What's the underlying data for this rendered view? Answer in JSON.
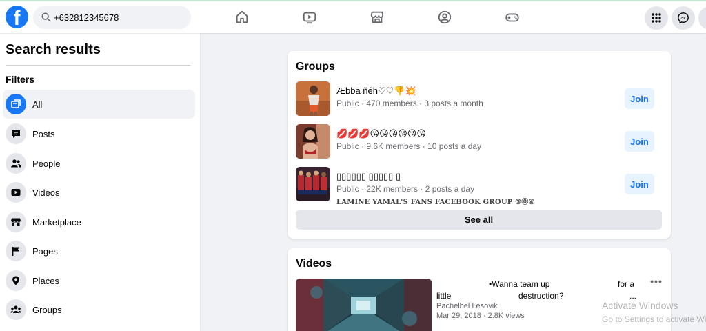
{
  "header": {
    "logo_letter": "f",
    "search_value": "+632812345678",
    "nav_icons": [
      "home-icon",
      "watch-icon",
      "marketplace-icon",
      "groups-icon",
      "gaming-icon"
    ],
    "right_icons": [
      "menu-grid-icon",
      "messenger-icon"
    ]
  },
  "sidebar": {
    "title": "Search results",
    "filters_label": "Filters",
    "items": [
      {
        "label": "All",
        "icon": "all-icon",
        "active": true
      },
      {
        "label": "Posts",
        "icon": "posts-icon"
      },
      {
        "label": "People",
        "icon": "people-icon"
      },
      {
        "label": "Videos",
        "icon": "videos-icon"
      },
      {
        "label": "Marketplace",
        "icon": "marketplace-icon"
      },
      {
        "label": "Pages",
        "icon": "pages-icon"
      },
      {
        "label": "Places",
        "icon": "places-icon"
      },
      {
        "label": "Groups",
        "icon": "groups-icon"
      }
    ]
  },
  "groups": {
    "title": "Groups",
    "items": [
      {
        "name": "Æbbā ñéh♡♡👎💥",
        "meta": "Public · 470 members · 3 posts a month",
        "join": "Join"
      },
      {
        "name": "💋💋💋😘😘😘😘😘😘",
        "meta": "Public · 9.6K members · 10 posts a day",
        "join": "Join"
      },
      {
        "name": "▯▯▯▯▯▯ ▯▯▯▯▯ ▯",
        "meta": "Public · 22K members · 2 posts a day",
        "extra": "LAMINE YAMAL'S FANS FACEBOOK GROUP ③⓪④",
        "join": "Join"
      }
    ],
    "see_all": "See all"
  },
  "videos": {
    "title": "Videos",
    "item": {
      "title_parts": [
        "•Wanna team up",
        "for a",
        "little",
        "destruction?",
        "..."
      ],
      "author": "Pachelbel Lesovik",
      "meta": "Mar 29, 2018 · 2.8K views",
      "more": "•••"
    }
  },
  "watermark": {
    "line1": "Activate Windows",
    "line2": "Go to Settings to activate Windows."
  },
  "colors": {
    "brand": "#1877f2",
    "background": "#f0f2f5",
    "join_bg": "#e7f3ff"
  }
}
